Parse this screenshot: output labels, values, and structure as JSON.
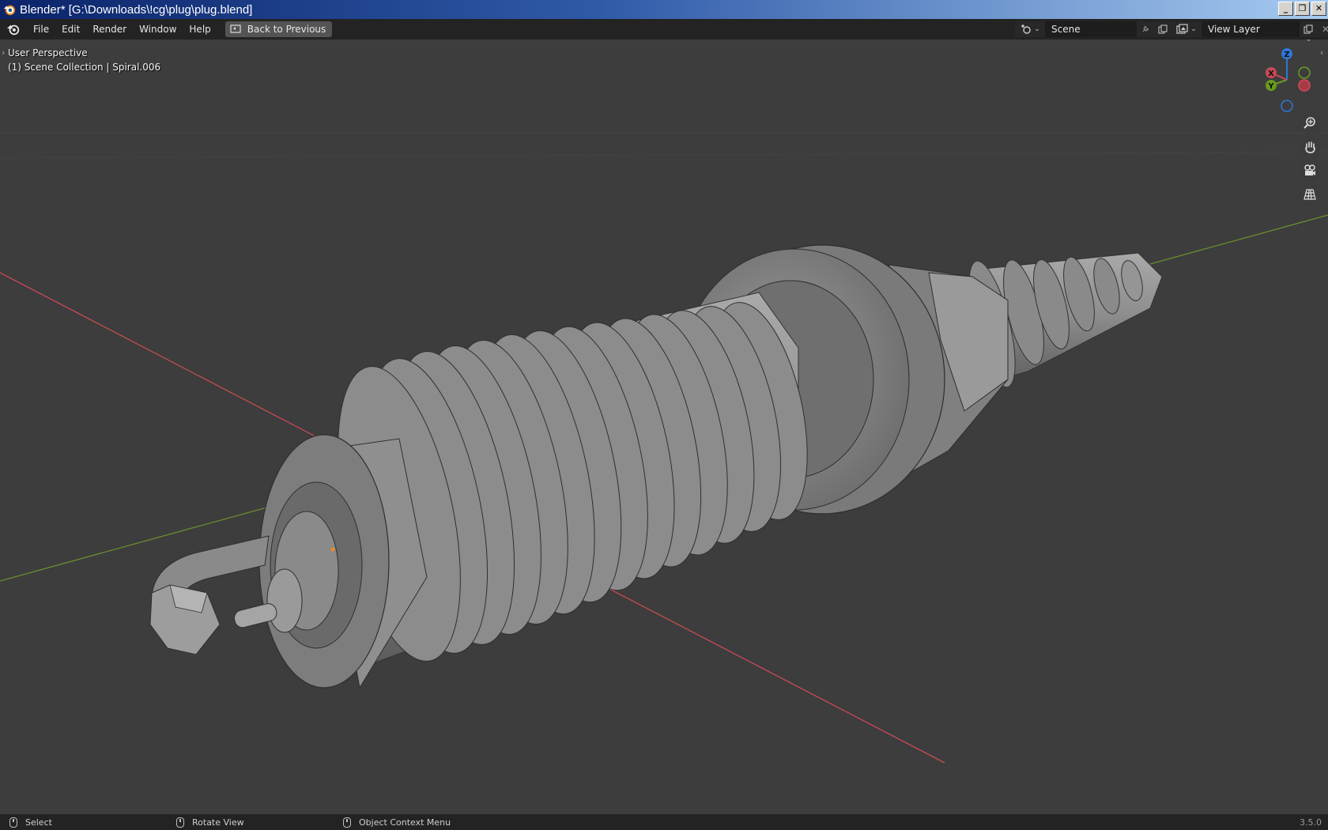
{
  "window": {
    "title": "Blender* [G:\\Downloads\\!cg\\plug\\plug.blend]",
    "buttons": {
      "minimize": "_",
      "maximize": "❐",
      "close": "✕"
    }
  },
  "menu": {
    "items": [
      "File",
      "Edit",
      "Render",
      "Window",
      "Help"
    ],
    "back_button": "Back to Previous"
  },
  "scene_selector": {
    "value": "Scene",
    "icon": "scene-icon"
  },
  "view_layer_selector": {
    "value": "View Layer",
    "icon": "view-layer-icon"
  },
  "viewport": {
    "view_name": "User Perspective",
    "collection_info": "(1) Scene Collection | Spiral.006",
    "gizmo": {
      "z": "Z",
      "y": "Y",
      "x": "X"
    },
    "colors": {
      "background": "#3d3d3d",
      "x_axis": "#c74a55",
      "y_axis": "#6b8f2f",
      "z_axis": "#2f77d6"
    },
    "nav_icons": [
      "zoom-icon",
      "hand-pan-icon",
      "camera-icon",
      "grid-ortho-icon"
    ]
  },
  "statusbar": {
    "select": "Select",
    "rotate": "Rotate View",
    "context_menu": "Object Context Menu",
    "version": "3.5.0"
  }
}
